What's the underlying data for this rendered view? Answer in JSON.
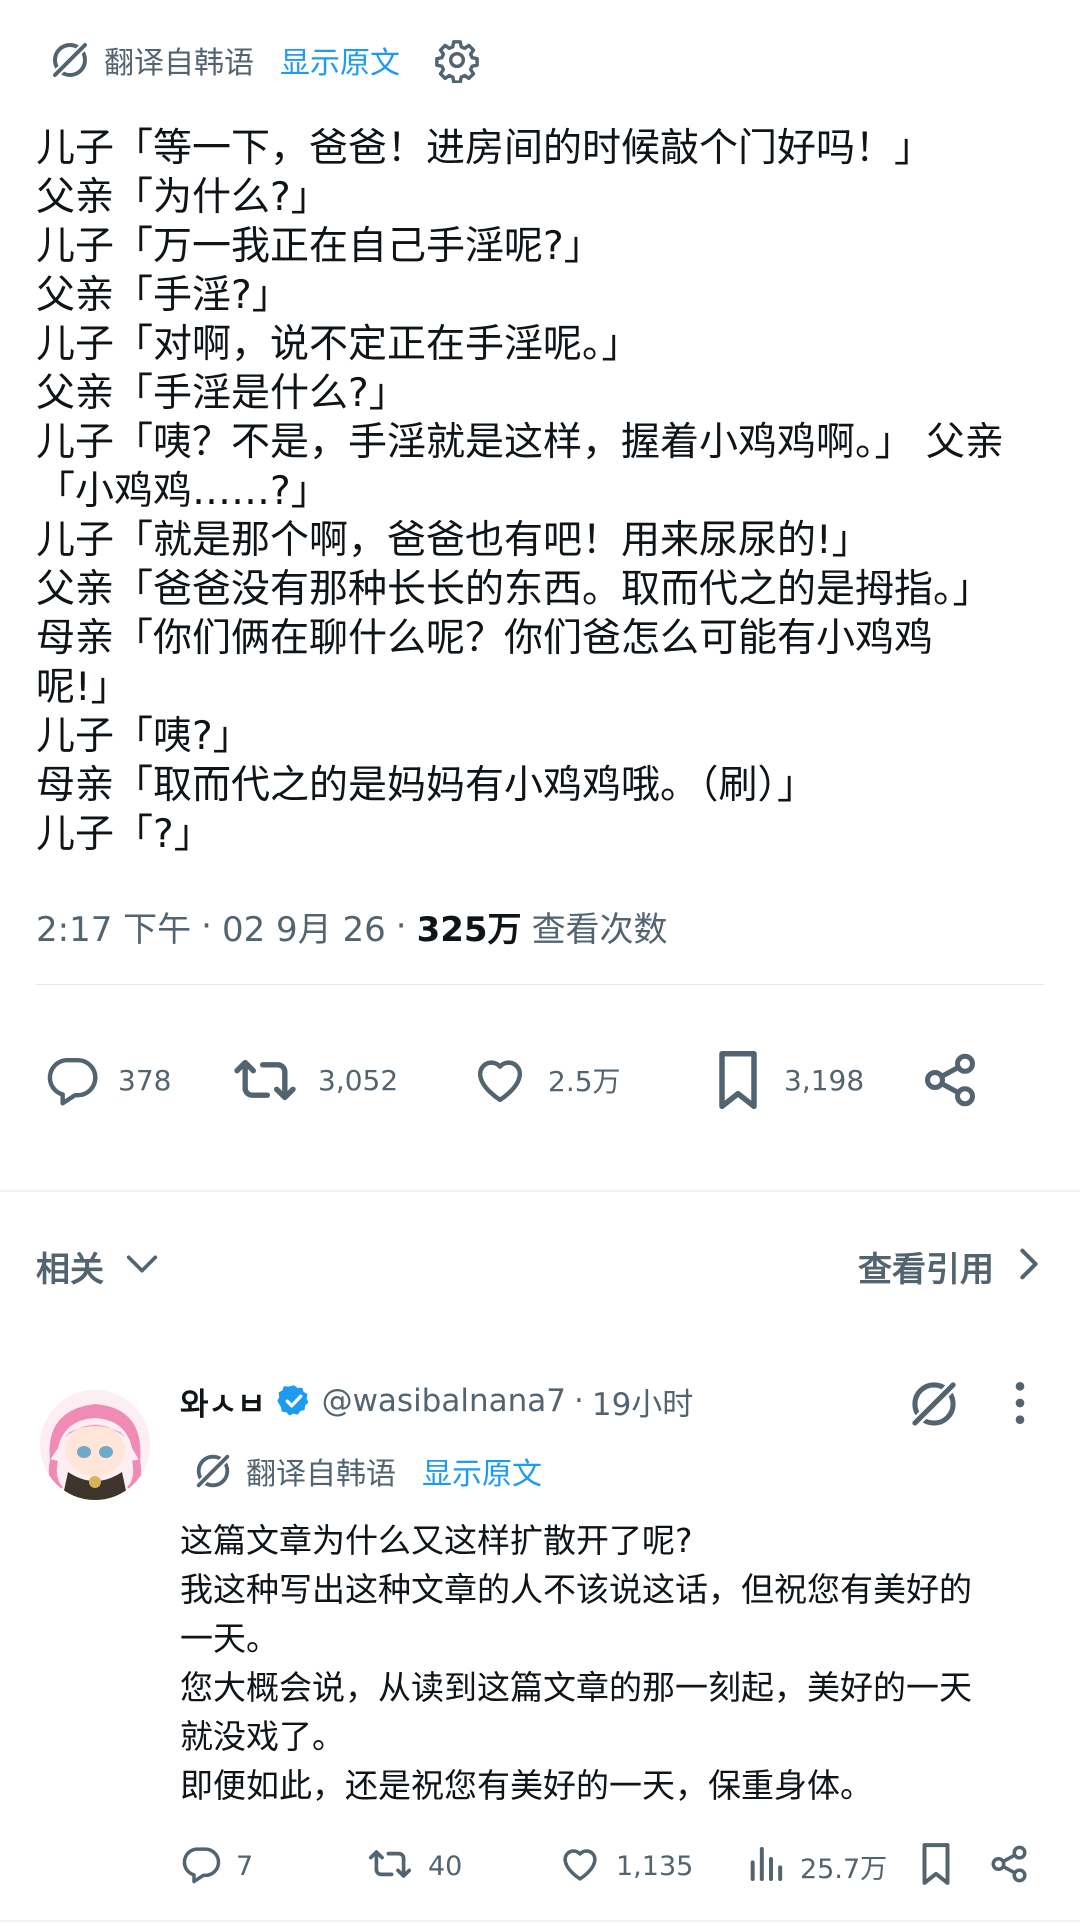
{
  "translation": {
    "label": "翻译自韩语",
    "show_original": "显示原文"
  },
  "tweet": {
    "lines": [
      "儿子「等一下，爸爸！进房间的时候敲个门好吗！」",
      "父亲「为什么?」",
      "儿子「万一我正在自己手淫呢?」",
      "父亲「手淫?」",
      "儿子「对啊，说不定正在手淫呢。」",
      "父亲「手淫是什么?」",
      "儿子「咦？不是，手淫就是这样，握着小鸡鸡啊。」 父亲",
      "「小鸡鸡……?」",
      "儿子「就是那个啊，爸爸也有吧！用来尿尿的!」",
      "父亲「爸爸没有那种长长的东西。取而代之的是拇指。」",
      "母亲「你们俩在聊什么呢？你们爸怎么可能有小鸡鸡",
      "呢!」",
      "儿子「咦?」",
      "母亲「取而代之的是妈妈有小鸡鸡哦。（刷）」",
      "儿子「?」"
    ],
    "time": "2:17 下午",
    "date": "02 9月 26",
    "separator": "·",
    "views_count": "325万",
    "views_label": "查看次数",
    "replies": "378",
    "retweets": "3,052",
    "likes": "2.5万",
    "bookmarks": "3,198"
  },
  "related": {
    "label": "相关",
    "quotes_label": "查看引用"
  },
  "reply": {
    "name": "와ㅅㅂ",
    "handle": "@wasibalnana7",
    "separator": "·",
    "time": "19小时",
    "translation_label": "翻译自韩语",
    "show_original": "显示原文",
    "lines": [
      "这篇文章为什么又这样扩散开了呢?",
      "我这种写出这种文章的人不该说这话，但祝您有美好的",
      "一天。",
      "您大概会说，从读到这篇文章的那一刻起，美好的一天",
      "就没戏了。",
      "即便如此，还是祝您有美好的一天，保重身体。"
    ],
    "replies": "7",
    "retweets": "40",
    "likes": "1,135",
    "views": "25.7万"
  },
  "colors": {
    "accent": "#1d9bf0",
    "muted": "#536471",
    "text": "#0f1419",
    "divider": "#eff3f4"
  },
  "icons": [
    "grok-translate-icon",
    "gear-icon",
    "reply-icon",
    "retweet-icon",
    "like-icon",
    "bookmark-icon",
    "share-icon",
    "chevron-down-icon",
    "chevron-right-icon",
    "verified-badge-icon",
    "more-icon",
    "views-icon"
  ]
}
